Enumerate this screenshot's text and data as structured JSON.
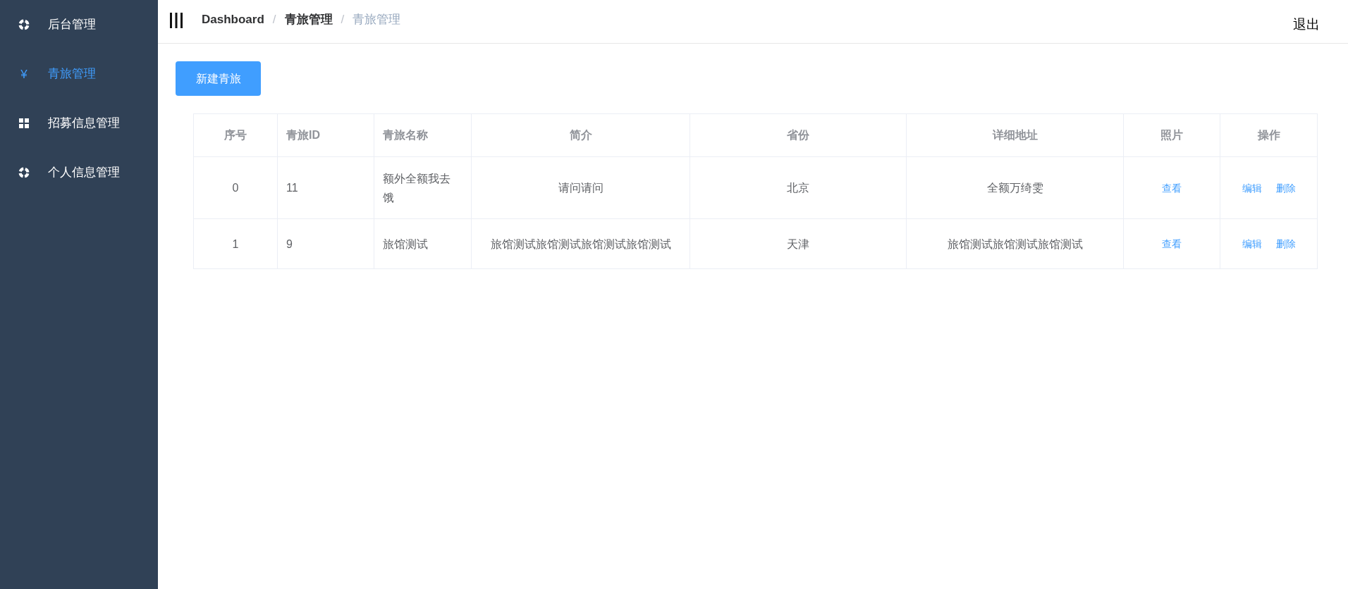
{
  "sidebar": {
    "items": [
      {
        "label": "后台管理",
        "kind": "ring",
        "selected": false
      },
      {
        "label": "青旅管理",
        "kind": "glyph",
        "glyph": "¥",
        "selected": true
      },
      {
        "label": "招募信息管理",
        "kind": "grid",
        "selected": false
      },
      {
        "label": "个人信息管理",
        "kind": "ring",
        "selected": false
      }
    ]
  },
  "header": {
    "breadcrumb": [
      "Dashboard",
      "青旅管理",
      "青旅管理"
    ],
    "separator": "/",
    "logout": "退出"
  },
  "toolbar": {
    "create_button": "新建青旅"
  },
  "table": {
    "columns": [
      "序号",
      "青旅ID",
      "青旅名称",
      "简介",
      "省份",
      "详细地址",
      "照片",
      "操作"
    ],
    "rows": [
      {
        "cells": [
          "0",
          "11",
          "额外全额我去饿",
          "请问请问",
          "北京",
          "全额万绮雯"
        ],
        "photo_link": "查看",
        "actions": [
          "编辑",
          "删除"
        ]
      },
      {
        "cells": [
          "1",
          "9",
          "旅馆测试",
          "旅馆测试旅馆测试旅馆测试旅馆测试",
          "天津",
          "旅馆测试旅馆测试旅馆测试"
        ],
        "photo_link": "查看",
        "actions": [
          "编辑",
          "删除"
        ]
      }
    ]
  }
}
